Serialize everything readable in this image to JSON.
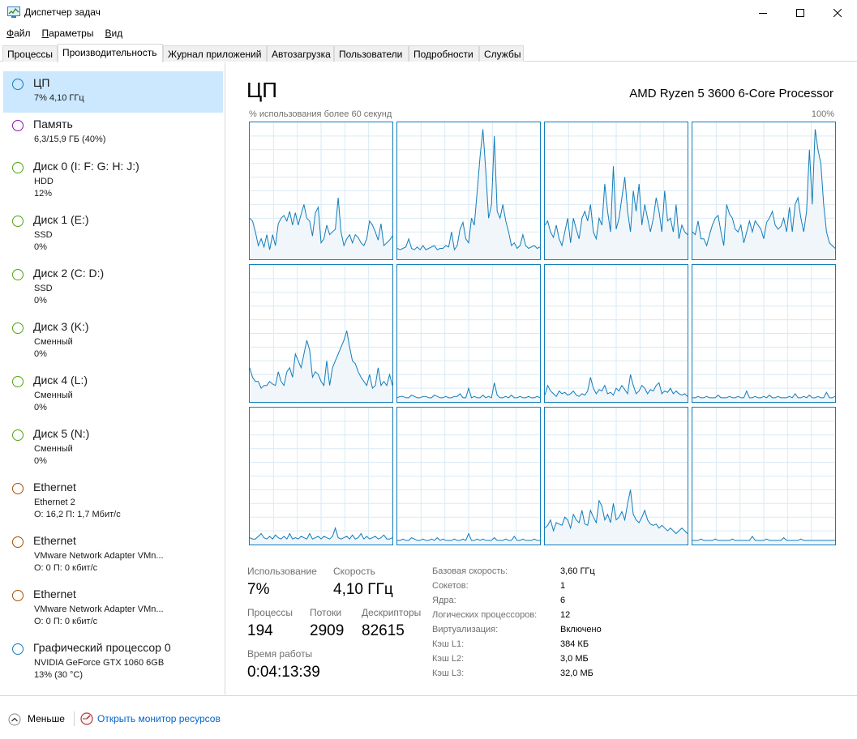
{
  "window": {
    "title": "Диспетчер задач"
  },
  "menu": [
    {
      "label": "Файл",
      "accel": "Ф",
      "rest": "айл"
    },
    {
      "label": "Параметры",
      "accel": "П",
      "rest": "араметры"
    },
    {
      "label": "Вид",
      "accel": "В",
      "rest": "ид"
    }
  ],
  "tabs": [
    {
      "label": "Процессы",
      "active": false
    },
    {
      "label": "Производительность",
      "active": true
    },
    {
      "label": "Журнал приложений",
      "active": false
    },
    {
      "label": "Автозагрузка",
      "active": false
    },
    {
      "label": "Пользователи",
      "active": false
    },
    {
      "label": "Подробности",
      "active": false
    },
    {
      "label": "Службы",
      "active": false
    }
  ],
  "sidebar": {
    "items": [
      {
        "title": "ЦП",
        "sub1": "7% 4,10 ГГц",
        "sub2": "",
        "color": "#117dbb",
        "selected": true
      },
      {
        "title": "Память",
        "sub1": "6,3/15,9 ГБ (40%)",
        "sub2": "",
        "color": "#8b12ae",
        "selected": false
      },
      {
        "title": "Диск 0 (I: F: G: H: J:)",
        "sub1": "HDD",
        "sub2": "12%",
        "color": "#4da60c",
        "selected": false
      },
      {
        "title": "Диск 1 (E:)",
        "sub1": "SSD",
        "sub2": "0%",
        "color": "#4da60c",
        "selected": false
      },
      {
        "title": "Диск 2 (C: D:)",
        "sub1": "SSD",
        "sub2": "0%",
        "color": "#4da60c",
        "selected": false
      },
      {
        "title": "Диск 3 (K:)",
        "sub1": "Сменный",
        "sub2": "0%",
        "color": "#4da60c",
        "selected": false
      },
      {
        "title": "Диск 4 (L:)",
        "sub1": "Сменный",
        "sub2": "0%",
        "color": "#4da60c",
        "selected": false
      },
      {
        "title": "Диск 5 (N:)",
        "sub1": "Сменный",
        "sub2": "0%",
        "color": "#4da60c",
        "selected": false
      },
      {
        "title": "Ethernet",
        "sub1": "Ethernet 2",
        "sub2": "О: 16,2 П: 1,7 Мбит/с",
        "color": "#a74f01",
        "selected": false
      },
      {
        "title": "Ethernet",
        "sub1": "VMware Network Adapter VMn...",
        "sub2": "О: 0 П: 0 кбит/с",
        "color": "#a74f01",
        "selected": false
      },
      {
        "title": "Ethernet",
        "sub1": "VMware Network Adapter VMn...",
        "sub2": "О: 0 П: 0 кбит/с",
        "color": "#a74f01",
        "selected": false
      },
      {
        "title": "Графический процессор 0",
        "sub1": "NVIDIA GeForce GTX 1060 6GB",
        "sub2": "13% (30 °C)",
        "color": "#117dbb",
        "selected": false
      }
    ]
  },
  "cpu": {
    "title": "ЦП",
    "processor": "AMD Ryzen 5 3600 6-Core Processor",
    "graph_caption": "% использования более 60 секунд",
    "graph_max": "100%",
    "stats": {
      "usage_label": "Использование",
      "usage_value": "7%",
      "speed_label": "Скорость",
      "speed_value": "4,10 ГГц",
      "processes_label": "Процессы",
      "processes_value": "194",
      "threads_label": "Потоки",
      "threads_value": "2909",
      "handles_label": "Дескрипторы",
      "handles_value": "82615",
      "uptime_label": "Время работы",
      "uptime_value": "0:04:13:39"
    },
    "specs": [
      {
        "label": "Базовая скорость:",
        "value": "3,60 ГГц"
      },
      {
        "label": "Сокетов:",
        "value": "1"
      },
      {
        "label": "Ядра:",
        "value": "6"
      },
      {
        "label": "Логических процессоров:",
        "value": "12"
      },
      {
        "label": "Виртуализация:",
        "value": "Включено"
      },
      {
        "label": "Кэш L1:",
        "value": "384 КБ"
      },
      {
        "label": "Кэш L2:",
        "value": "3,0 МБ"
      },
      {
        "label": "Кэш L3:",
        "value": "32,0 МБ"
      }
    ]
  },
  "footer": {
    "fewer_label": "Меньше",
    "resmon_label": "Открыть монитор ресурсов"
  },
  "colors": {
    "accent": "#117dbb",
    "selection": "#cce8ff",
    "graph_fill": "#f1f6fa",
    "grid": "#d9eaf4"
  },
  "chart_data": {
    "type": "area",
    "title": "",
    "ylim": [
      0,
      100
    ],
    "series": [
      {
        "values": [
          30,
          28,
          20,
          10,
          15,
          9,
          18,
          7,
          18,
          10,
          26,
          30,
          32,
          28,
          35,
          25,
          34,
          25,
          33,
          40,
          30,
          28,
          17,
          34,
          38,
          12,
          15,
          25,
          18,
          20,
          22,
          45,
          20,
          10,
          15,
          18,
          12,
          18,
          16,
          12,
          10,
          15,
          28,
          25,
          20,
          14,
          26,
          10,
          12,
          14,
          17
        ]
      },
      {
        "values": [
          8,
          7,
          8,
          9,
          15,
          8,
          7,
          9,
          7,
          10,
          7,
          8,
          9,
          10,
          7,
          8,
          8,
          10,
          9,
          20,
          7,
          10,
          22,
          27,
          15,
          12,
          30,
          25,
          50,
          75,
          95,
          65,
          30,
          40,
          90,
          35,
          30,
          40,
          28,
          20,
          10,
          12,
          8,
          10,
          18,
          10,
          8,
          9,
          10,
          8,
          9
        ]
      },
      {
        "values": [
          25,
          28,
          20,
          16,
          25,
          15,
          10,
          20,
          30,
          12,
          30,
          22,
          15,
          30,
          35,
          28,
          40,
          20,
          15,
          30,
          25,
          55,
          35,
          20,
          68,
          22,
          30,
          45,
          60,
          35,
          20,
          50,
          35,
          55,
          25,
          40,
          30,
          20,
          30,
          45,
          35,
          20,
          50,
          28,
          30,
          20,
          40,
          15,
          25,
          20,
          18
        ]
      },
      {
        "values": [
          20,
          18,
          28,
          15,
          15,
          10,
          18,
          25,
          30,
          32,
          20,
          10,
          40,
          33,
          30,
          22,
          20,
          25,
          12,
          20,
          28,
          20,
          28,
          25,
          22,
          15,
          27,
          30,
          35,
          25,
          22,
          24,
          30,
          20,
          38,
          20,
          40,
          45,
          30,
          20,
          35,
          80,
          40,
          95,
          80,
          70,
          40,
          20,
          12,
          10,
          8
        ]
      },
      {
        "values": [
          25,
          18,
          15,
          15,
          10,
          12,
          12,
          15,
          13,
          12,
          22,
          15,
          12,
          22,
          25,
          18,
          35,
          30,
          25,
          35,
          45,
          38,
          18,
          22,
          20,
          15,
          12,
          30,
          12,
          25,
          30,
          35,
          40,
          45,
          52,
          40,
          30,
          28,
          22,
          18,
          15,
          12,
          20,
          10,
          12,
          25,
          12,
          15,
          12,
          20,
          12
        ]
      },
      {
        "values": [
          3,
          4,
          4,
          3,
          3,
          5,
          4,
          3,
          3,
          4,
          4,
          3,
          3,
          5,
          4,
          3,
          3,
          4,
          3,
          3,
          4,
          4,
          6,
          3,
          3,
          10,
          3,
          4,
          3,
          3,
          5,
          3,
          4,
          3,
          14,
          5,
          3,
          3,
          4,
          3,
          5,
          3,
          3,
          4,
          3,
          3,
          4,
          3,
          3,
          4,
          3
        ]
      },
      {
        "values": [
          5,
          12,
          8,
          6,
          4,
          8,
          6,
          7,
          5,
          6,
          8,
          5,
          4,
          6,
          5,
          8,
          18,
          10,
          6,
          9,
          8,
          12,
          6,
          7,
          5,
          10,
          8,
          12,
          9,
          6,
          20,
          12,
          6,
          8,
          12,
          10,
          6,
          9,
          8,
          12,
          14,
          6,
          8,
          7,
          10,
          6,
          8,
          6,
          5,
          6,
          4
        ]
      },
      {
        "values": [
          3,
          3,
          4,
          3,
          3,
          4,
          3,
          3,
          3,
          5,
          3,
          3,
          3,
          4,
          3,
          3,
          4,
          3,
          3,
          8,
          3,
          3,
          4,
          3,
          3,
          4,
          3,
          5,
          3,
          3,
          4,
          3,
          3,
          3,
          4,
          3,
          6,
          3,
          3,
          4,
          3,
          5,
          3,
          3,
          4,
          3,
          3,
          7,
          3,
          3,
          4
        ]
      },
      {
        "values": [
          5,
          4,
          4,
          6,
          8,
          5,
          4,
          6,
          4,
          7,
          5,
          4,
          6,
          4,
          8,
          4,
          5,
          4,
          6,
          5,
          4,
          8,
          4,
          5,
          6,
          4,
          6,
          5,
          4,
          6,
          12,
          5,
          4,
          5,
          6,
          4,
          7,
          4,
          5,
          8,
          4,
          6,
          4,
          5,
          6,
          4,
          5,
          7,
          4,
          4,
          5
        ]
      },
      {
        "values": [
          3,
          3,
          4,
          3,
          3,
          5,
          4,
          3,
          3,
          4,
          3,
          3,
          4,
          3,
          5,
          3,
          4,
          3,
          3,
          3,
          4,
          3,
          3,
          4,
          3,
          8,
          3,
          3,
          4,
          3,
          4,
          3,
          3,
          3,
          5,
          3,
          3,
          3,
          4,
          3,
          3,
          6,
          3,
          3,
          4,
          3,
          3,
          3,
          4,
          3,
          3
        ]
      },
      {
        "values": [
          12,
          14,
          18,
          10,
          16,
          15,
          14,
          20,
          18,
          12,
          22,
          18,
          16,
          25,
          15,
          14,
          25,
          20,
          16,
          32,
          28,
          18,
          22,
          16,
          30,
          18,
          20,
          24,
          18,
          30,
          40,
          22,
          18,
          16,
          20,
          25,
          18,
          15,
          14,
          15,
          12,
          14,
          12,
          10,
          12,
          10,
          8,
          10,
          12,
          10,
          8
        ]
      },
      {
        "values": [
          3,
          3,
          3,
          4,
          3,
          3,
          3,
          3,
          4,
          3,
          3,
          3,
          3,
          3,
          4,
          3,
          3,
          3,
          3,
          3,
          3,
          6,
          3,
          3,
          3,
          3,
          4,
          3,
          3,
          3,
          3,
          3,
          5,
          3,
          3,
          3,
          3,
          3,
          4,
          3,
          3,
          3,
          3,
          3,
          3,
          3,
          3,
          3,
          3,
          3,
          3
        ]
      }
    ]
  }
}
